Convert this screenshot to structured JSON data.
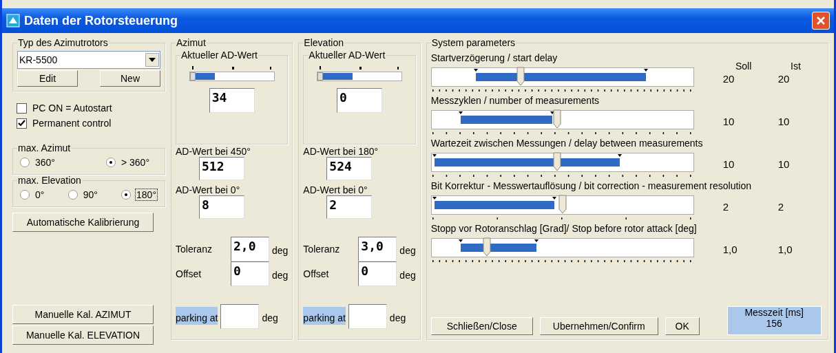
{
  "window": {
    "title": "Daten der Rotorsteuerung"
  },
  "rotor_type": {
    "legend": "Typ des Azimutrotors",
    "value": "KR-5500",
    "buttons": [
      "Edit",
      "New"
    ]
  },
  "options": [
    {
      "label": "PC ON = Autostart",
      "checked": false
    },
    {
      "label": "Permanent control",
      "checked": true
    }
  ],
  "max_azimut": {
    "legend": "max. Azimut",
    "choices": [
      {
        "label": "360°",
        "selected": false,
        "focused": false
      },
      {
        "label": "> 360°",
        "selected": true,
        "focused": false
      }
    ]
  },
  "max_elevation": {
    "legend": "max. Elevation",
    "choices": [
      {
        "label": "0°",
        "selected": false,
        "focused": false
      },
      {
        "label": "90°",
        "selected": false,
        "focused": false
      },
      {
        "label": "180°",
        "selected": true,
        "focused": true
      }
    ]
  },
  "auto_calibration": "Automatische Kalibrierung",
  "manual_buttons": [
    "Manuelle Kal. AZIMUT",
    "Manuelle Kal. ELEVATION"
  ],
  "axes": [
    {
      "legend": "Azimut",
      "current_legend": "Aktueller AD-Wert",
      "meter": {
        "level": 0,
        "selection_to": {
          "level": 0.3
        }
      },
      "value": "34",
      "ad_high": {
        "label": "AD-Wert bei 450°",
        "value": "512"
      },
      "ad_zero": {
        "label": "AD-Wert bei 0°",
        "value": "8"
      },
      "tolerance": {
        "label": "Toleranz",
        "value": "2,0",
        "unit": "deg"
      },
      "offset": {
        "label": "Offset",
        "value": "0",
        "unit": "deg"
      },
      "parking": {
        "label": "parking at",
        "unit": "deg"
      }
    },
    {
      "legend": "Elevation",
      "current_legend": "Aktueller AD-Wert",
      "meter": {
        "level": 0,
        "selection_to": {
          "level": 0.42
        }
      },
      "value": "0",
      "ad_high": {
        "label": "AD-Wert bei 180°",
        "value": "524"
      },
      "ad_zero": {
        "label": "AD-Wert bei 0°",
        "value": "2"
      },
      "tolerance": {
        "label": "Toleranz",
        "value": "3,0",
        "unit": "deg"
      },
      "offset": {
        "label": "Offset",
        "value": "0",
        "unit": "deg"
      },
      "parking": {
        "label": "parking at",
        "unit": "deg"
      }
    }
  ],
  "system": {
    "legend": "System parameters",
    "headers": [
      "Soll",
      "Ist"
    ],
    "sliders": [
      {
        "label": "Startverzögerung / start delay",
        "level": 0.34,
        "selection_from": {
          "level": 0.17
        },
        "selection_to": {
          "level": 0.82
        },
        "soll": "20",
        "ist": "20"
      },
      {
        "label": "Messzyklen / number of measurements",
        "level": 0.48,
        "selection_from": {
          "level": 0.11
        },
        "selection_to": {
          "level": 0.46
        },
        "soll": "10",
        "ist": "10"
      },
      {
        "label": "Wartezeit zwischen Messungen / delay between measurements",
        "level": 0.48,
        "selection_from": {
          "level": 0.01
        },
        "selection_to": {
          "level": 0.72
        },
        "soll": "10",
        "ist": "10"
      },
      {
        "label": "Bit Korrektur - Messwertauflösung / bit correction - measurement resolution",
        "level": 0.5,
        "selection_from": {
          "level": 0.01
        },
        "selection_to": {
          "level": 0.47
        },
        "soll": "2",
        "ist": "2"
      },
      {
        "label": "Stopp vor Rotoranschlag [Grad]/ Stop before rotor attack [deg]",
        "level": 0.21,
        "selection_from": {
          "level": 0.11
        },
        "selection_to": {
          "level": 0.4
        },
        "soll": "1,0",
        "ist": "1,0"
      }
    ],
    "buttons": [
      "Schließen/Close",
      "Ubernehmen/Confirm",
      "OK"
    ],
    "measure_time": {
      "legend": "Messzeit [ms]",
      "value": "156"
    }
  }
}
